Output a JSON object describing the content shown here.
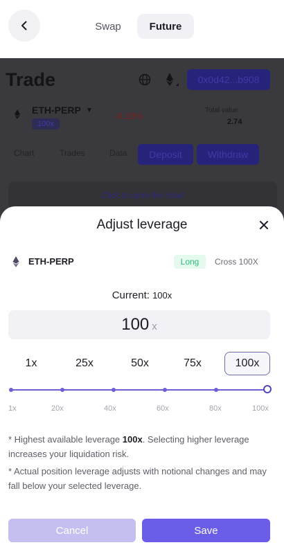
{
  "nav": {
    "swap_label": "Swap",
    "future_label": "Future"
  },
  "background": {
    "title": "Trade",
    "address": "0x0d42...b908",
    "pair": "ETH-PERP",
    "leverage": "100x",
    "change": "-0.19%",
    "total_value_label": "Total value",
    "total_value": "2.74",
    "tabs": [
      "Chart",
      "Trades",
      "Data"
    ],
    "deposit_label": "Deposit",
    "withdraw_label": "Withdraw",
    "chart_hint": "Click to open the chart"
  },
  "sheet": {
    "title": "Adjust leverage",
    "pair": "ETH-PERP",
    "side_badge": "Long",
    "margin_mode": "Cross 100X",
    "current_label": "Current:",
    "current_value": "100x",
    "input_value": "100",
    "input_unit": "x",
    "presets": [
      "1x",
      "25x",
      "50x",
      "75x",
      "100x"
    ],
    "selected_preset": "100x",
    "slider_value": 100,
    "slider_ticks": [
      "1x",
      "20x",
      "40x",
      "60x",
      "80x",
      "100x"
    ],
    "note1_prefix": "* Highest available leverage ",
    "note1_bold": "100x",
    "note1_suffix": ". Selecting higher leverage increases your liquidation risk.",
    "note2": "* Actual position leverage adjusts with notional changes and may fall below your selected leverage.",
    "cancel_label": "Cancel",
    "save_label": "Save"
  },
  "colors": {
    "accent": "#6a5ee8",
    "accent_light": "#c4bff0",
    "long_green": "#2fbf7a",
    "dim_overlay": "#3a3a3e"
  }
}
